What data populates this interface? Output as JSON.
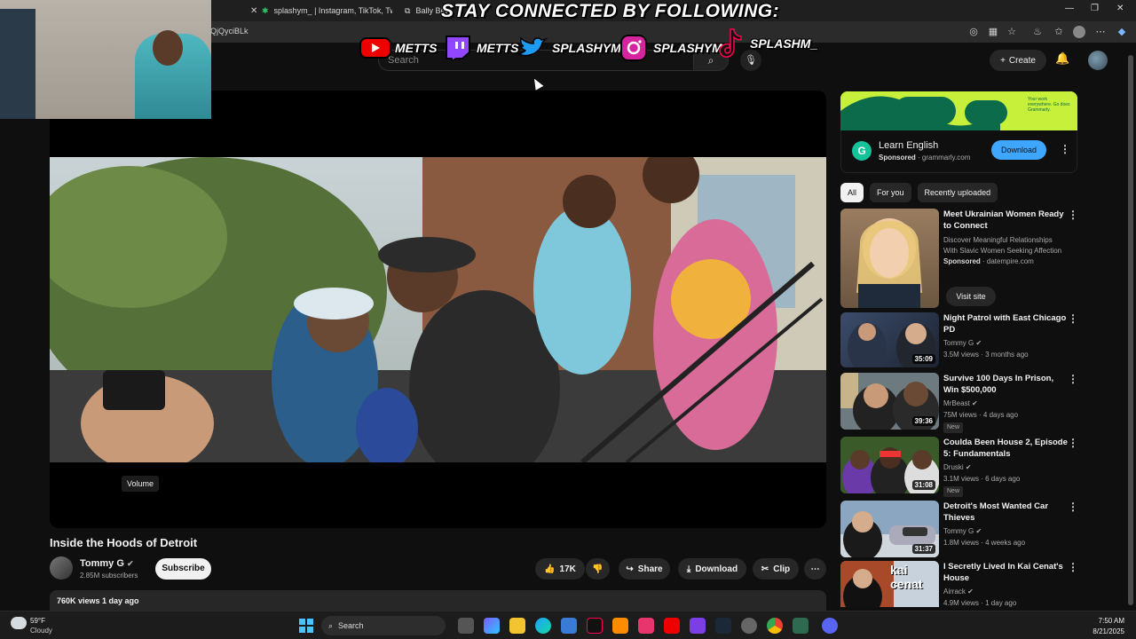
{
  "browser": {
    "tabs": [
      {
        "label": "splashym_ | Instagram, TikTok, Tw"
      },
      {
        "label": "Bally Bet"
      }
    ],
    "url": "QjQyciBLk"
  },
  "overlay": {
    "banner": "STAY CONNECTED BY FOLLOWING:",
    "socials": [
      {
        "platform": "youtube-icon",
        "name": "METTS"
      },
      {
        "platform": "twitch-icon",
        "name": "METTS"
      },
      {
        "platform": "twitter-icon",
        "name": "SPLASHYM_"
      },
      {
        "platform": "instagram-icon",
        "name": "SPLASHYM_"
      },
      {
        "platform": "tiktok-icon",
        "name": "SPLASHM_"
      }
    ]
  },
  "header": {
    "search_placeholder": "Search",
    "create_label": "Create"
  },
  "player": {
    "volume_tooltip": "Volume"
  },
  "video": {
    "title": "Inside the Hoods of Detroit",
    "channel": "Tommy G",
    "subscribers": "2.85M subscribers",
    "subscribe_label": "Subscribe",
    "likes": "17K",
    "share_label": "Share",
    "download_label": "Download",
    "clip_label": "Clip",
    "views_date": "760K views  1 day ago"
  },
  "ad": {
    "banner_text": "Your work everywhere. Go does Grammarly.",
    "title": "Learn English",
    "sponsored": "Sponsored",
    "domain": "grammarly.com",
    "button": "Download"
  },
  "chips": [
    "All",
    "For you",
    "Recently uploaded"
  ],
  "recommendations": [
    {
      "title": "Meet Ukrainian Women Ready to Connect",
      "line1": "Discover Meaningful Relationships With Slavic Women Seeking Affection",
      "line2": "· datempire.com",
      "sponsored": "Sponsored",
      "visit": "Visit site"
    },
    {
      "title": "Night Patrol with East Chicago PD",
      "channel": "Tommy G",
      "meta": "3.5M views · 3 months ago",
      "duration": "35:09"
    },
    {
      "title": "Survive 100 Days In Prison, Win $500,000",
      "channel": "MrBeast",
      "meta": "75M views · 4 days ago",
      "duration": "39:36",
      "badge": "New"
    },
    {
      "title": "Coulda Been House 2, Episode 5: Fundamentals",
      "channel": "Druski",
      "meta": "3.1M views · 6 days ago",
      "duration": "31:08",
      "badge": "New"
    },
    {
      "title": "Detroit's Most Wanted Car Thieves",
      "channel": "Tommy G",
      "meta": "1.8M views · 4 weeks ago",
      "duration": "31:37"
    },
    {
      "title": "I Secretly Lived In Kai Cenat's House",
      "channel": "Airrack",
      "meta": "4.9M views · 1 day ago",
      "thumb_text": "kai cenat"
    }
  ],
  "taskbar": {
    "temp": "59°F",
    "condition": "Cloudy",
    "search": "Search",
    "time": "7:50 AM",
    "date": "8/21/2025"
  }
}
